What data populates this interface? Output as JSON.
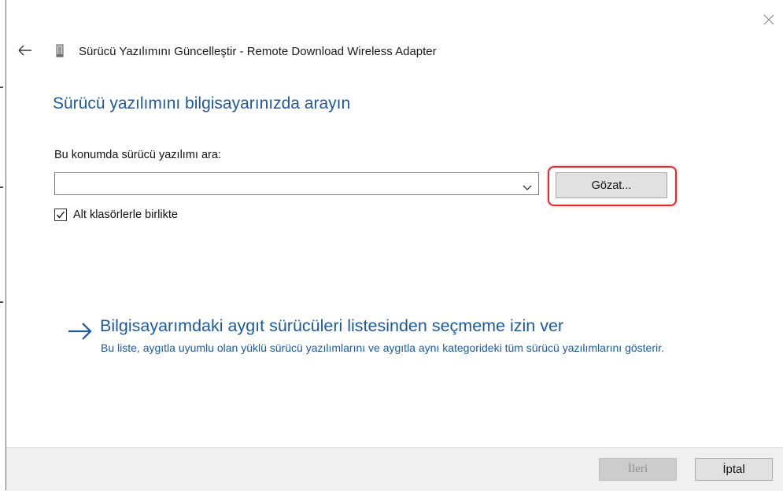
{
  "window": {
    "title": "Sürücü Yazılımını Güncelleştir - Remote Download Wireless Adapter",
    "close_icon": "close-icon",
    "back_icon": "back-arrow-icon",
    "device_icon": "device-icon"
  },
  "main": {
    "heading": "Sürücü yazılımını bilgisayarınızda arayın",
    "location_label": "Bu konumda sürücü yazılımı ara:",
    "location_value": "",
    "browse_label": "Gözat...",
    "include_subfolders_label": "Alt klasörlerle birlikte",
    "include_subfolders_checked": true,
    "highlight_color": "#e02b2b"
  },
  "pick_from_list": {
    "title": "Bilgisayarımdaki aygıt sürücüleri listesinden seçmeme izin ver",
    "description": "Bu liste, aygıtla uyumlu olan yüklü sürücü yazılımlarını ve aygıtla aynı kategorideki tüm sürücü yazılımlarını gösterir.",
    "arrow_icon": "right-arrow-icon",
    "color": "#1d5a9c"
  },
  "footer": {
    "next_label": "İleri",
    "next_enabled": false,
    "cancel_label": "İptal"
  }
}
